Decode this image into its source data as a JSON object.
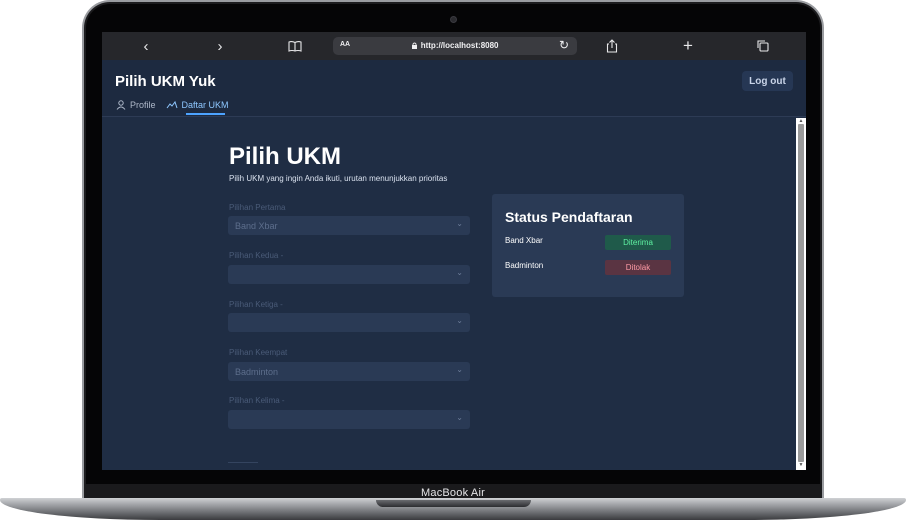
{
  "device": {
    "label": "MacBook Air"
  },
  "browser": {
    "url": "http://localhost:8080",
    "text_size_label": "AA",
    "icons": [
      "back-icon",
      "forward-icon",
      "bookmarks-icon",
      "lock-icon",
      "reload-icon",
      "share-icon",
      "new-tab-icon",
      "tabs-icon"
    ]
  },
  "app": {
    "title": "Pilih UKM Yuk",
    "logout_label": "Log out",
    "nav": [
      {
        "label": "Profile",
        "icon": "user-icon",
        "active": false
      },
      {
        "label": "Daftar UKM",
        "icon": "list-icon",
        "active": true
      }
    ]
  },
  "page": {
    "title": "Pilih UKM",
    "subtitle": "Pilih UKM yang ingin Anda ikuti, urutan menunjukkan prioritas",
    "fields": [
      {
        "label": "Pilihan Pertama",
        "value": "Band Xbar"
      },
      {
        "label": "Pilihan Kedua -",
        "value": ""
      },
      {
        "label": "Pilihan Ketiga -",
        "value": ""
      },
      {
        "label": "Pilihan Keempat",
        "value": "Badminton"
      },
      {
        "label": "Pilihan Kelima -",
        "value": ""
      }
    ]
  },
  "status": {
    "title": "Status Pendaftaran",
    "items": [
      {
        "name": "Band Xbar",
        "status": "Diterima"
      },
      {
        "name": "Badminton",
        "status": "Ditolak"
      }
    ]
  },
  "colors": {
    "background": "#1f2d44",
    "card": "#2a3a55",
    "accepted_text": "#5ff2a2",
    "rejected_text": "#ff9aa6",
    "active_nav": "#8ec7ff"
  }
}
